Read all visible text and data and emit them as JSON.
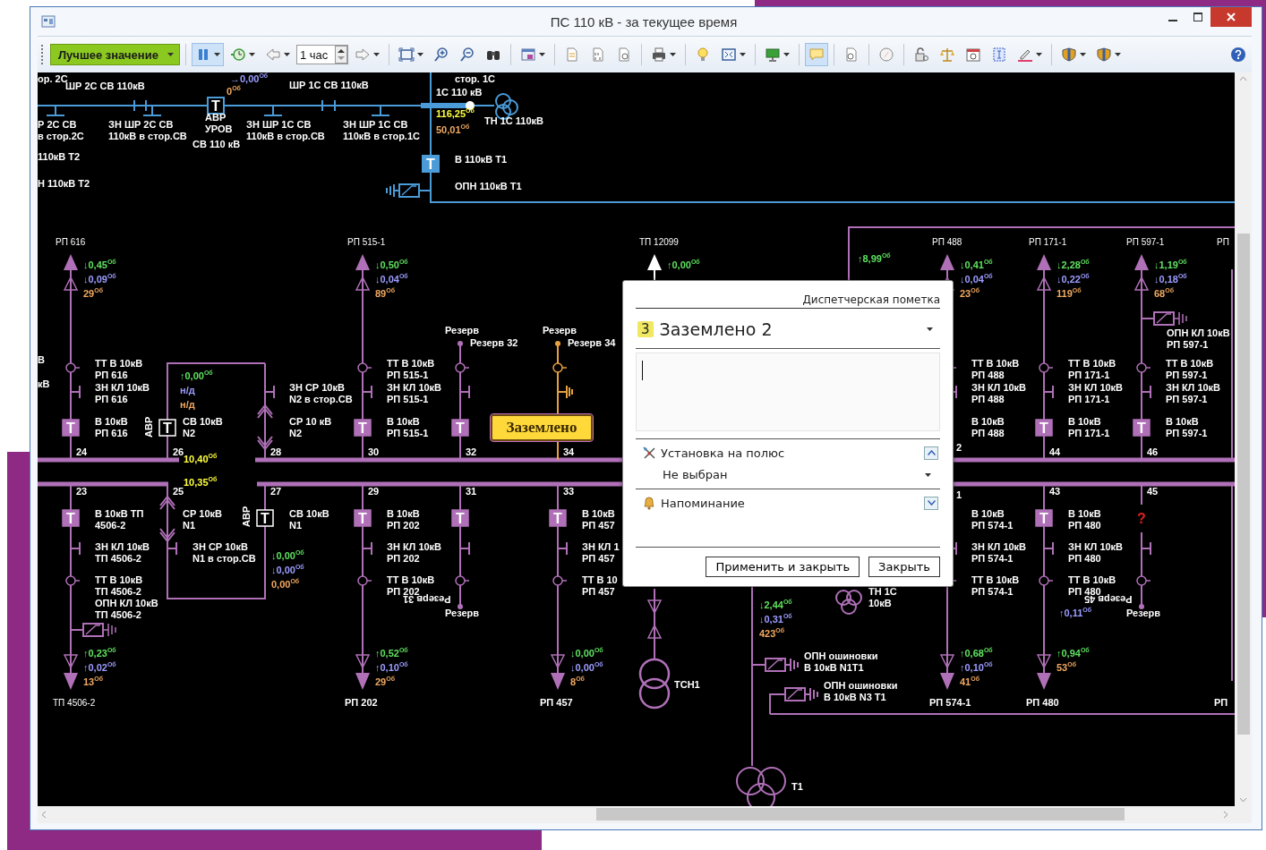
{
  "window": {
    "title": "ПС 110 кВ - за текущее время"
  },
  "toolbar": {
    "items": [
      {
        "kind": "mode",
        "label": "Лучшее значение",
        "dropdown": true,
        "selected": false
      },
      {
        "kind": "separator"
      },
      {
        "kind": "pause",
        "dropdown": true,
        "selected": true
      },
      {
        "kind": "history",
        "dropdown": true,
        "selected": false
      },
      {
        "kind": "back",
        "dropdown": true,
        "selected": false
      },
      {
        "kind": "period",
        "value": "1 час"
      },
      {
        "kind": "forward",
        "dropdown": true,
        "selected": false
      },
      {
        "kind": "separator"
      },
      {
        "kind": "fit",
        "dropdown": true,
        "selected": false
      },
      {
        "kind": "zoom-in",
        "dropdown": false,
        "selected": false
      },
      {
        "kind": "zoom-out",
        "dropdown": false,
        "selected": false
      },
      {
        "kind": "binoculars",
        "dropdown": false,
        "selected": false
      },
      {
        "kind": "separator"
      },
      {
        "kind": "save-window",
        "dropdown": true,
        "selected": false
      },
      {
        "kind": "separator"
      },
      {
        "kind": "document",
        "dropdown": false,
        "selected": false
      },
      {
        "kind": "binary-document",
        "dropdown": false,
        "selected": false
      },
      {
        "kind": "find-document",
        "dropdown": false,
        "selected": false
      },
      {
        "kind": "separator"
      },
      {
        "kind": "printer",
        "dropdown": true,
        "selected": false
      },
      {
        "kind": "separator"
      },
      {
        "kind": "lightbulb",
        "dropdown": false,
        "selected": false
      },
      {
        "kind": "fullscreen",
        "dropdown": true,
        "selected": false
      },
      {
        "kind": "separator"
      },
      {
        "kind": "monitor",
        "dropdown": true,
        "selected": false
      },
      {
        "kind": "separator"
      },
      {
        "kind": "comment",
        "dropdown": false,
        "selected": true
      },
      {
        "kind": "separator"
      },
      {
        "kind": "page-search",
        "dropdown": false,
        "selected": false
      },
      {
        "kind": "separator"
      },
      {
        "kind": "compass",
        "dropdown": false,
        "selected": false
      },
      {
        "kind": "separator"
      },
      {
        "kind": "lock",
        "dropdown": false,
        "selected": false
      },
      {
        "kind": "scales",
        "dropdown": false,
        "selected": false
      },
      {
        "kind": "calendar",
        "dropdown": false,
        "selected": false
      },
      {
        "kind": "text-select",
        "dropdown": false,
        "selected": false
      },
      {
        "kind": "pen",
        "dropdown": true,
        "selected": false
      },
      {
        "kind": "separator"
      },
      {
        "kind": "shield",
        "dropdown": true,
        "selected": false
      },
      {
        "kind": "shield",
        "dropdown": true,
        "selected": false
      },
      {
        "kind": "help",
        "selected": false
      }
    ]
  },
  "hv_breakers": [
    {
      "mark": "T",
      "closed": false
    },
    {
      "mark": "T",
      "closed": true
    }
  ],
  "labels": [
    {
      "kind": "text",
      "text": "ор. 2С"
    },
    {
      "kind": "text",
      "text": "ШР 2С СВ 110кВ"
    },
    {
      "kind": "reactive",
      "text": "→0,00$^{Об}$"
    },
    {
      "kind": "current",
      "text": "0$^{Об}$"
    },
    {
      "kind": "text",
      "text": "стор. 1С"
    },
    {
      "kind": "text",
      "text": "ШР 1С СВ 110кВ"
    },
    {
      "kind": "text",
      "text": "1С 110 кВ"
    },
    {
      "kind": "voltage",
      "text": "116,25$^{Об}$"
    },
    {
      "kind": "current",
      "text": "50,01$^{Об}$"
    },
    {
      "kind": "text",
      "text": "ТН 1С 110кВ"
    },
    {
      "kind": "text",
      "text": "Р 2С СВ\nв стор.2С"
    },
    {
      "kind": "text",
      "text": "ЗН ШР 2С СВ\n110кВ в стор.СВ"
    },
    {
      "kind": "text",
      "text": "АВР\nУРОВ"
    },
    {
      "kind": "text",
      "text": "СВ 110 кВ"
    },
    {
      "kind": "text",
      "text": "ЗН ШР 1С СВ\n110кВ в стор.СВ"
    },
    {
      "kind": "text",
      "text": "ЗН ШР 1С СВ\n110кВ в стор.1С"
    },
    {
      "kind": "text",
      "text": "110кВ Т2"
    },
    {
      "kind": "text",
      "text": "В 110кВ Т1"
    },
    {
      "kind": "text",
      "text": "Н 110кВ Т2"
    },
    {
      "kind": "text",
      "text": "ОПН 110кВ Т1"
    },
    {
      "kind": "text",
      "text": "В"
    },
    {
      "kind": "text",
      "text": "кВ"
    },
    {
      "kind": "active",
      "text": "↑8,99$^{Об}$"
    },
    {
      "kind": "text",
      "text": "2"
    },
    {
      "kind": "text",
      "text": "1"
    },
    {
      "kind": "text",
      "text": "ТН 1С\n10кВ"
    },
    {
      "kind": "active",
      "text": "↓2,44$^{Об}$"
    },
    {
      "kind": "reactive",
      "text": "↓0,31$^{Об}$"
    },
    {
      "kind": "current",
      "text": "423$^{Об}$"
    },
    {
      "kind": "text",
      "text": "ОПН ошиновки\nВ 10кВ N1T1"
    },
    {
      "kind": "text",
      "text": "ОПН ошиновки\nВ 10кВ N3 T1"
    },
    {
      "kind": "text",
      "text": "T1"
    },
    {
      "kind": "reactive",
      "text": "↑0,11$^{Об}$"
    }
  ],
  "buses": [
    {
      "reading": "10,40$^{Об}$"
    },
    {
      "reading": "10,35$^{Об}$"
    }
  ],
  "upper_feeders": [
    {
      "kind": "line",
      "number": "24",
      "end_name": "РП 616",
      "breaker": {
        "kind": "breaker",
        "mark": "T",
        "closed": true
      },
      "labels": {
        "breaker": "В 10кВ\nРП 616",
        "earth": "ЗН КЛ 10кВ\nРП 616",
        "ct": "ТТ В 10кВ\nРП 616"
      },
      "readings": [
        {
          "kind": "active",
          "text": "↓0,45$^{Об}$"
        },
        {
          "kind": "reactive",
          "text": "↓0,09$^{Об}$"
        },
        {
          "kind": "current",
          "text": "29$^{Об}$"
        }
      ]
    },
    {
      "kind": "sectional_breaker",
      "number": "26",
      "avr": "АВР",
      "breaker": {
        "kind": "breaker",
        "mark": "T",
        "closed": false
      },
      "labels": {
        "breaker": "СВ 10кВ\nN2"
      },
      "readings": [
        {
          "kind": "active",
          "text": "↑0,00$^{Об}$"
        },
        {
          "kind": "reactive",
          "text": "н/д"
        },
        {
          "kind": "current",
          "text": "н/д"
        }
      ]
    },
    {
      "kind": "sectional_disconnector",
      "number": "28",
      "labels": {
        "earth": "ЗН СР 10кВ\nN2 в стор.СВ",
        "switch": "СР 10 кВ\nN2"
      }
    },
    {
      "kind": "line",
      "number": "30",
      "end_name": "РП 515-1",
      "breaker": {
        "kind": "breaker",
        "mark": "T",
        "closed": true
      },
      "labels": {
        "breaker": "В 10кВ\nРП 515-1",
        "earth": "ЗН КЛ 10кВ\nРП 515-1",
        "ct": "ТТ В 10кВ\nРП 515-1"
      },
      "readings": [
        {
          "kind": "active",
          "text": "↓0,50$^{Об}$"
        },
        {
          "kind": "reactive",
          "text": "↓0,04$^{Об}$"
        },
        {
          "kind": "current",
          "text": "89$^{Об}$"
        }
      ]
    },
    {
      "kind": "reserve",
      "number": "32",
      "title": "Резерв",
      "name": "Резерв 32",
      "grounded": false,
      "breaker": {
        "kind": "breaker",
        "mark": "T",
        "closed": true
      }
    },
    {
      "kind": "reserve",
      "number": "34",
      "title": "Резерв",
      "name": "Резерв 34",
      "grounded": true,
      "tag": "Заземлено"
    },
    {
      "kind": "transit",
      "end_name": "ТП 12099",
      "readings": [
        {
          "kind": "active",
          "text": "↑0,00$^{Об}$"
        }
      ]
    },
    {
      "kind": "line",
      "end_name": "РП 488",
      "labels": {
        "breaker": "В 10кВ\nРП 488",
        "earth": "ЗН КЛ 10кВ\nРП 488",
        "ct": "ТТ В 10кВ\nРП 488"
      },
      "readings": [
        {
          "kind": "active",
          "text": "↓0,41$^{Об}$"
        },
        {
          "kind": "reactive",
          "text": "↓0,04$^{Об}$"
        },
        {
          "kind": "current",
          "text": "23$^{Об}$"
        }
      ]
    },
    {
      "kind": "line",
      "number": "44",
      "end_name": "РП 171-1",
      "breaker": {
        "kind": "breaker",
        "mark": "T",
        "closed": true
      },
      "labels": {
        "breaker": "В 10кВ\nРП 171-1",
        "earth": "ЗН КЛ 10кВ\nРП 171-1",
        "ct": "ТТ В 10кВ\nРП 171-1"
      },
      "readings": [
        {
          "kind": "active",
          "text": "↓2,28$^{Об}$"
        },
        {
          "kind": "reactive",
          "text": "↓0,22$^{Об}$"
        },
        {
          "kind": "current",
          "text": "119$^{Об}$"
        }
      ]
    },
    {
      "kind": "line",
      "number": "46",
      "end_name": "РП 597-1",
      "breaker": {
        "kind": "breaker",
        "mark": "T",
        "closed": true
      },
      "labels": {
        "breaker": "В 10кВ\nРП 597-1",
        "earth": "ЗН КЛ 10кВ\nРП 597-1",
        "ct": "ТТ В 10кВ\nРП 597-1",
        "opn": "ОПН КЛ 10кВ\nРП 597-1"
      },
      "readings": [
        {
          "kind": "active",
          "text": "↓1,19$^{Об}$"
        },
        {
          "kind": "reactive",
          "text": "↓0,18$^{Об}$"
        },
        {
          "kind": "current",
          "text": "68$^{Об}$"
        }
      ]
    },
    {
      "kind": "stub",
      "end_name": "РП"
    }
  ],
  "lower_feeders": [
    {
      "kind": "line",
      "number": "23",
      "end_name": "ТП 4506-2",
      "breaker": {
        "kind": "breaker",
        "mark": "T",
        "closed": true
      },
      "labels": {
        "breaker": "В 10кВ ТП\n4506-2",
        "earth": "ЗН КЛ 10кВ\nТП 4506-2",
        "ct": "ТТ В 10кВ\nТП 4506-2",
        "opn": "ОПН КЛ 10кВ\nТП 4506-2"
      },
      "readings": [
        {
          "kind": "active",
          "text": "↑0,23$^{Об}$"
        },
        {
          "kind": "reactive",
          "text": "↑0,02$^{Об}$"
        },
        {
          "kind": "current",
          "text": "13$^{Об}$"
        }
      ]
    },
    {
      "kind": "sectional_disconnector",
      "number": "25",
      "labels": {
        "switch": "СР 10кВ\nN1",
        "earth": "ЗН СР 10кВ\nN1 в стор.СВ"
      }
    },
    {
      "kind": "sectional_breaker",
      "number": "27",
      "avr": "АВР",
      "breaker": {
        "kind": "breaker",
        "mark": "T",
        "closed": false
      },
      "labels": {
        "breaker": "СВ 10кВ\nN1"
      },
      "readings": [
        {
          "kind": "active",
          "text": "↓0,00$^{Об}$"
        },
        {
          "kind": "reactive",
          "text": "↓0,00$^{Об}$"
        },
        {
          "kind": "current",
          "text": "0,00$^{Об}$"
        }
      ]
    },
    {
      "kind": "line",
      "number": "29",
      "end_name": "РП 202",
      "breaker": {
        "kind": "breaker",
        "mark": "T",
        "closed": true
      },
      "labels": {
        "breaker": "В 10кВ\nРП 202",
        "earth": "ЗН КЛ 10кВ\nРП 202",
        "ct": "ТТ В 10кВ\nРП 202"
      },
      "readings": [
        {
          "kind": "active",
          "text": "↑0,52$^{Об}$"
        },
        {
          "kind": "reactive",
          "text": "↑0,10$^{Об}$"
        },
        {
          "kind": "current",
          "text": "29$^{Об}$"
        }
      ]
    },
    {
      "kind": "reserve",
      "number": "31",
      "title": "Резерв",
      "name": "Резерв 31",
      "grounded": false,
      "breaker": {
        "kind": "breaker",
        "mark": "T",
        "closed": true
      }
    },
    {
      "kind": "line",
      "number": "33",
      "end_name": "РП 457",
      "breaker": {
        "kind": "breaker",
        "mark": "T",
        "closed": true
      },
      "labels": {
        "breaker": "В 10кВ\nРП 457",
        "earth": "ЗН КЛ 1\nРП 457",
        "ct": "ТТ В 10\nРП 457"
      },
      "readings": [
        {
          "kind": "active",
          "text": "↓0,00$^{Об}$"
        },
        {
          "kind": "reactive",
          "text": "↓0,00$^{Об}$"
        },
        {
          "kind": "current",
          "text": "8$^{Об}$"
        }
      ]
    },
    {
      "kind": "transformer",
      "name": "ТСН1"
    },
    {
      "kind": "line",
      "end_name": "РП 574-1",
      "labels": {
        "breaker": "В 10кВ\nРП 574-1",
        "earth": "ЗН КЛ 10кВ\nРП 574-1",
        "ct": "ТТ В 10кВ\nРП 574-1"
      },
      "readings": [
        {
          "kind": "active",
          "text": "↑0,68$^{Об}$"
        },
        {
          "kind": "reactive",
          "text": "↑0,10$^{Об}$"
        },
        {
          "kind": "current",
          "text": "41$^{Об}$"
        }
      ]
    },
    {
      "kind": "line",
      "number": "43",
      "end_name": "РП 480",
      "breaker": {
        "kind": "breaker",
        "mark": "T",
        "closed": true
      },
      "labels": {
        "breaker": "В 10кВ\nРП 480",
        "earth": "ЗН КЛ 10кВ\nРП 480",
        "ct": "ТТ В 10кВ\nРП 480"
      },
      "readings": [
        {
          "kind": "active",
          "text": "↑0,94$^{Об}$"
        },
        {
          "kind": "current",
          "text": "53$^{Об}$"
        }
      ]
    },
    {
      "kind": "reserve",
      "number": "45",
      "title": "Резерв",
      "name": "Резерв 45",
      "grounded": false,
      "breaker": {
        "kind": "unknown",
        "mark": "?"
      }
    },
    {
      "kind": "stub",
      "end_name": "РП"
    }
  ],
  "dialog": {
    "header": "Диспетчерская пометка",
    "badge": "3",
    "title": "Заземлено 2",
    "sections": [
      {
        "kind": "pole",
        "label": "Установка на полюс",
        "expanded": true,
        "value": "Не выбран"
      },
      {
        "kind": "reminder",
        "label": "Напоминание",
        "expanded": false
      }
    ],
    "buttons": [
      "Применить и закрыть",
      "Закрыть"
    ]
  }
}
